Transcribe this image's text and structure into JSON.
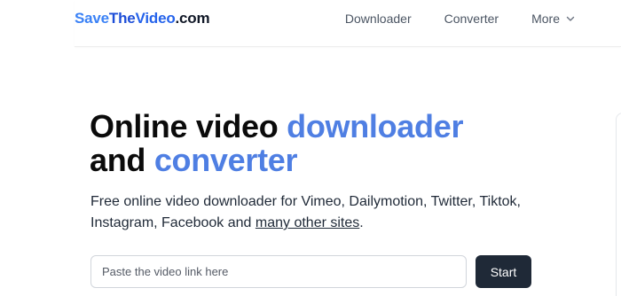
{
  "header": {
    "logo_parts": [
      "Save",
      "The",
      "Video",
      ".com"
    ],
    "nav": {
      "downloader": "Downloader",
      "converter": "Converter",
      "more": "More"
    },
    "more_icon": "chevron-down-icon"
  },
  "hero": {
    "title_line1": "Online video ",
    "title_line1_accent": "downloader",
    "title_line2": "and ",
    "title_line2_accent": "converter",
    "description_before_link": "Free online video downloader for Vimeo, Dailymotion, Twitter, Tiktok, Instagram, Facebook and ",
    "description_link": "many other sites",
    "description_after_link": "."
  },
  "search": {
    "placeholder": "Paste the video link here",
    "value": "",
    "button_label": "Start"
  },
  "colors": {
    "accent": "#4f7fe3",
    "logo_blue": "#2563eb",
    "button_dark": "#1f2937"
  }
}
